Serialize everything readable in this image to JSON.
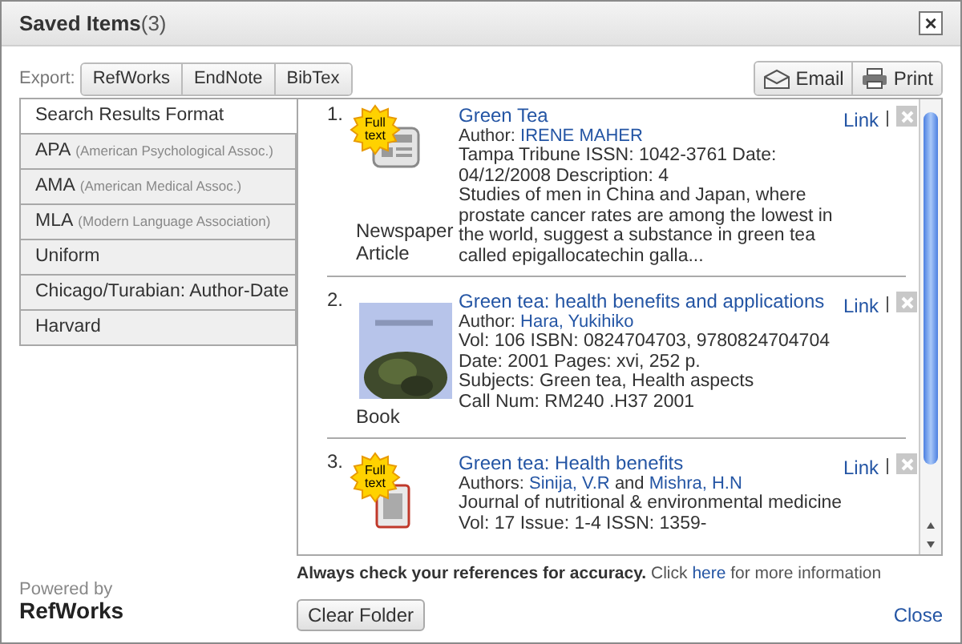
{
  "window": {
    "title": "Saved Items",
    "count": "(3)",
    "close": "×"
  },
  "export": {
    "label": "Export:",
    "buttons": [
      "RefWorks",
      "EndNote",
      "BibTex"
    ]
  },
  "actions": [
    {
      "kind": "email",
      "label": "Email"
    },
    {
      "kind": "print",
      "label": "Print"
    }
  ],
  "formats": [
    {
      "name": "Search Results Format",
      "selected": true
    },
    {
      "name": "APA",
      "note": "(American Psychological Assoc.)",
      "selected": false
    },
    {
      "name": "AMA",
      "note": "(American Medical Assoc.)",
      "selected": false
    },
    {
      "name": "MLA",
      "note": "(Modern Language Association)",
      "selected": false
    },
    {
      "name": "Uniform",
      "selected": false
    },
    {
      "name": "Chicago/Turabian: Author-Date",
      "selected": false
    },
    {
      "name": "Harvard",
      "selected": false
    }
  ],
  "results": [
    {
      "number": "1.",
      "kind": "newspaper",
      "full_text": true,
      "badge": "Full text",
      "type": "Newspaper Article",
      "title": "Green Tea",
      "author_label": "Author:",
      "authors": [
        "IRENE MAHER"
      ],
      "details": [
        "Tampa Tribune ISSN: 1042-3761 Date: 04/12/2008 Description: 4",
        "Studies of men in China and Japan, where prostate cancer rates are among the lowest in the world, suggest a substance in green tea called epigallocatechin galla..."
      ],
      "link": "Link"
    },
    {
      "number": "2.",
      "kind": "picture",
      "full_text": false,
      "type": "Book",
      "title": "Green tea: health benefits and applications",
      "author_label": "Author:",
      "authors": [
        "Hara, Yukihiko"
      ],
      "details": [
        "Vol: 106 ISBN: 0824704703, 9780824704704 Date: 2001 Pages: xvi, 252 p.",
        "Subjects: Green tea, Health aspects",
        "Call Num: RM240 .H37 2001"
      ],
      "link": "Link"
    },
    {
      "number": "3.",
      "kind": "journal",
      "full_text": true,
      "badge": "Full text",
      "title": "Green tea: Health benefits",
      "author_label": "Authors:",
      "authors": [
        "Sinija, V.R",
        "Mishra, H.N"
      ],
      "author_joiner": "and",
      "details": [
        "Journal of nutritional & environmental medicine Vol: 17 Issue: 1-4 ISSN: 1359-"
      ],
      "link": "Link"
    }
  ],
  "notice": {
    "bold": "Always check your references for accuracy.",
    "before_link": "Click",
    "link": "here",
    "after_link": "for more information"
  },
  "powered": {
    "line1": "Powered by",
    "line2": "RefWorks"
  },
  "clear_button": "Clear Folder",
  "close_link": "Close"
}
